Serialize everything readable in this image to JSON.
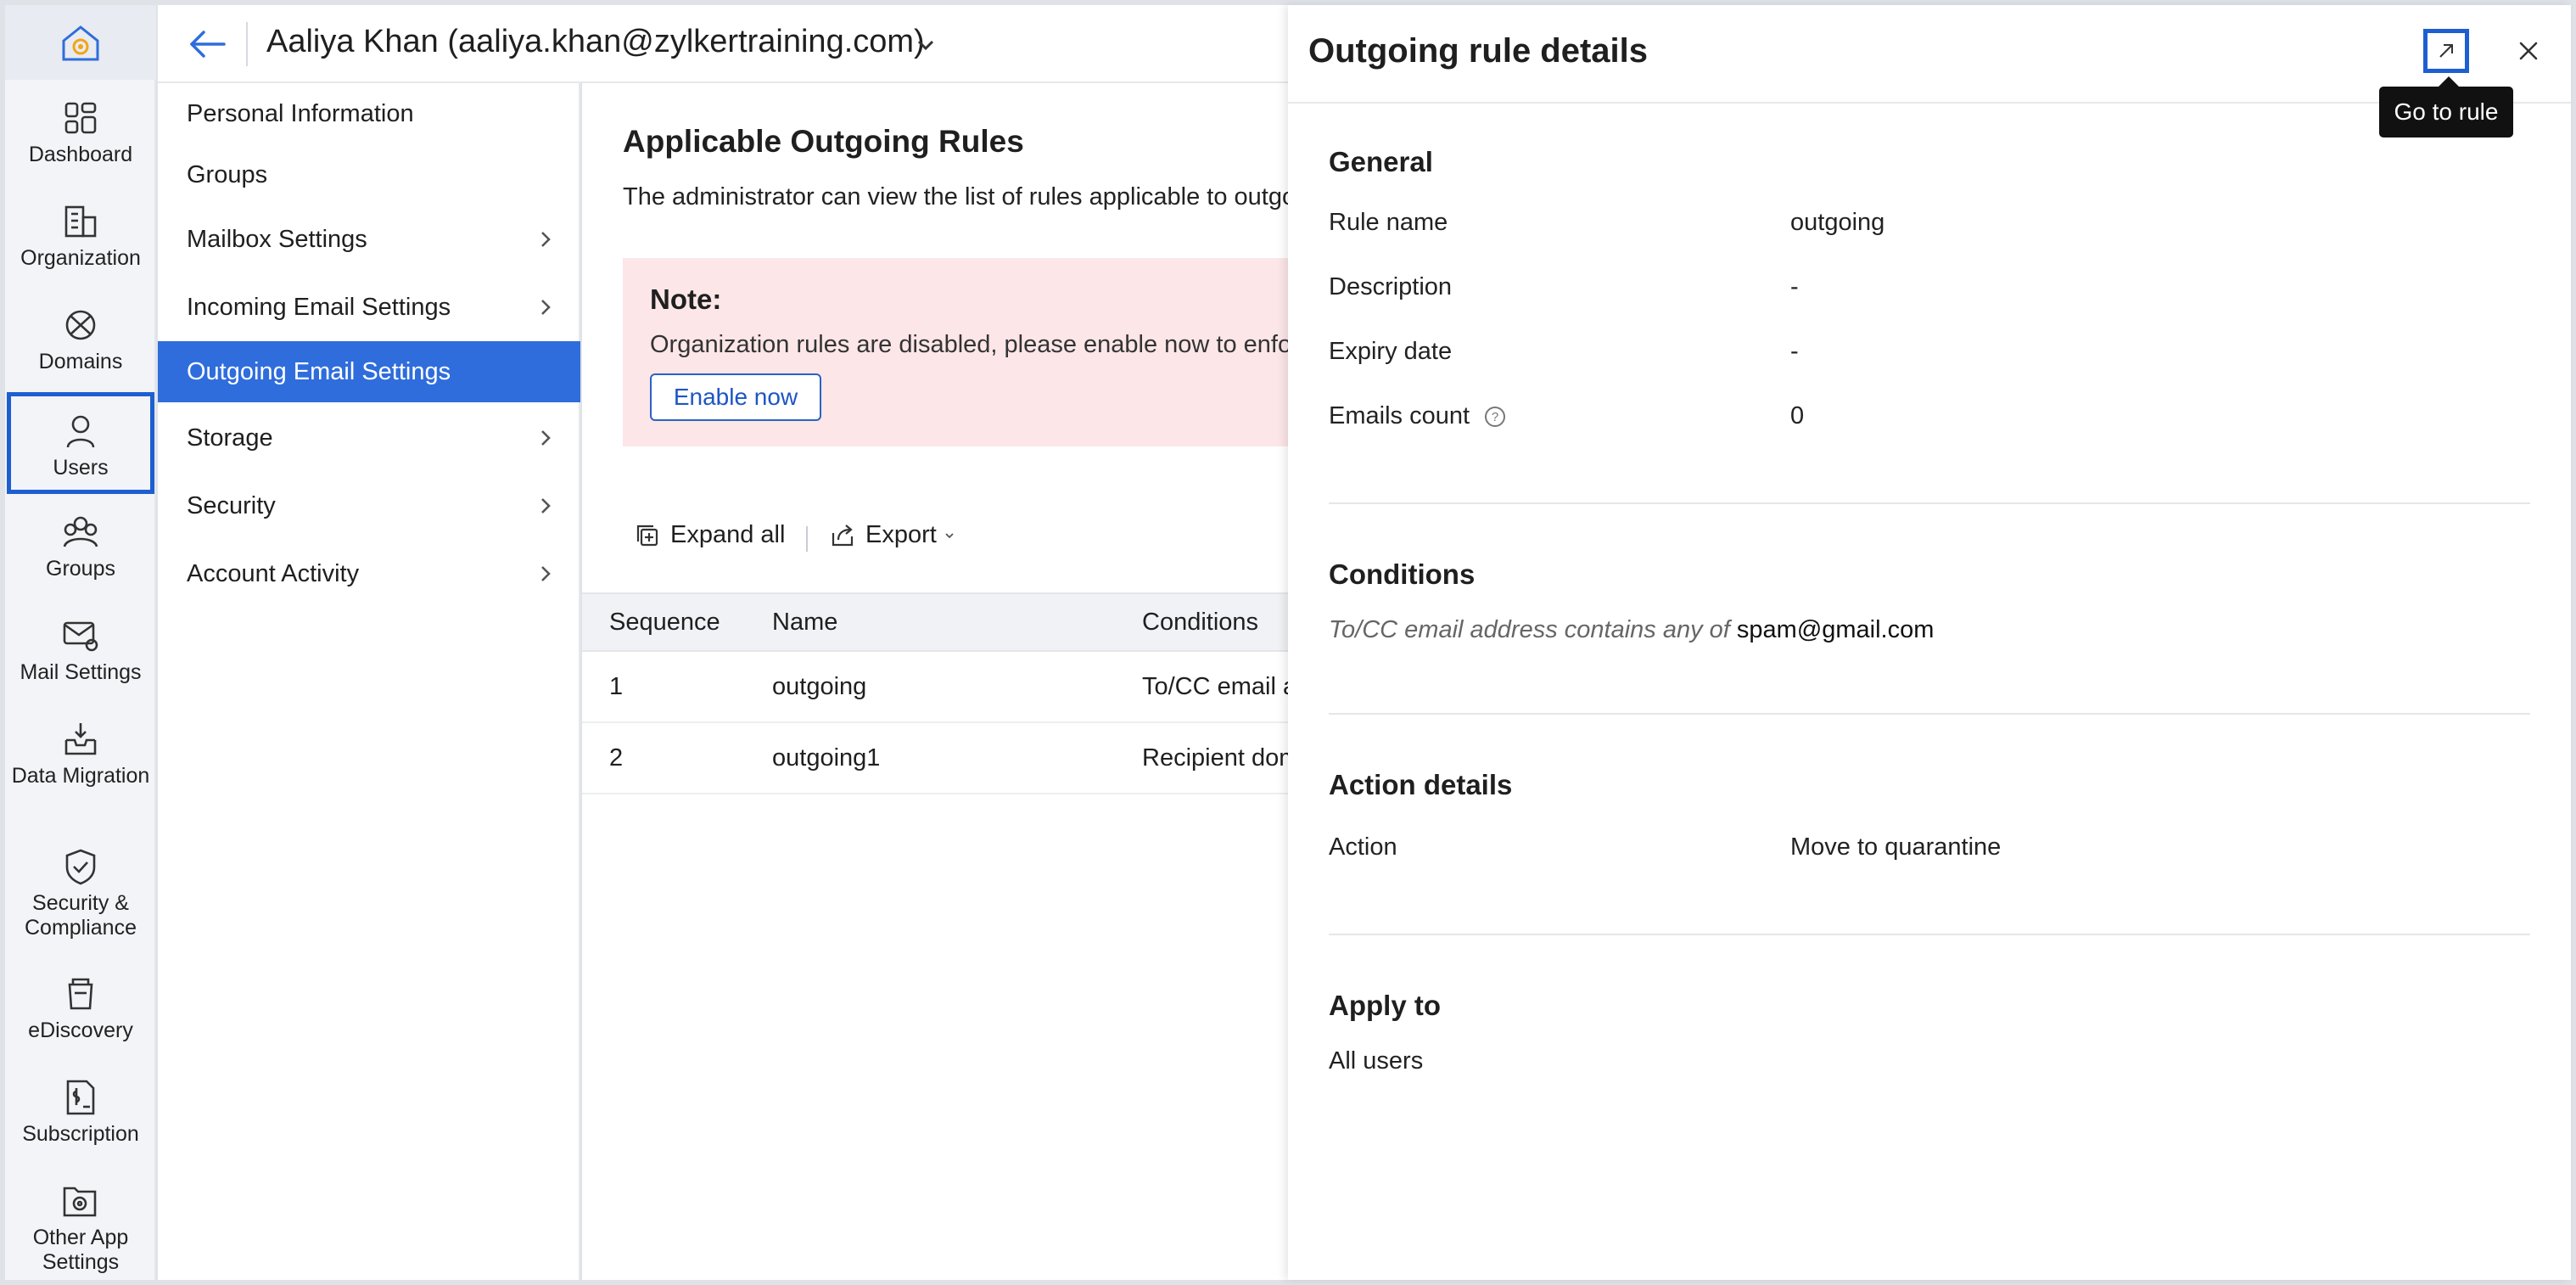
{
  "rail": {
    "items": [
      {
        "label": "Dashboard",
        "icon": "dashboard-icon"
      },
      {
        "label": "Organization",
        "icon": "organization-icon"
      },
      {
        "label": "Domains",
        "icon": "domains-icon"
      },
      {
        "label": "Users",
        "icon": "user-icon",
        "active": true
      },
      {
        "label": "Groups",
        "icon": "groups-icon"
      },
      {
        "label": "Mail Settings",
        "icon": "mail-settings-icon"
      },
      {
        "label": "Data Migration",
        "icon": "data-migration-icon"
      },
      {
        "label": "Security & Compliance",
        "icon": "shield-check-icon"
      },
      {
        "label": "eDiscovery",
        "icon": "ediscovery-icon"
      },
      {
        "label": "Subscription",
        "icon": "subscription-icon"
      },
      {
        "label": "Other App Settings",
        "icon": "app-settings-icon"
      }
    ]
  },
  "header": {
    "user_title": "Aaliya Khan (aaliya.khan@zylkertraining.com)"
  },
  "subnav": {
    "items": [
      {
        "label": "Personal Information",
        "has_chevron": false
      },
      {
        "label": "Groups",
        "has_chevron": false
      },
      {
        "label": "Mailbox Settings",
        "has_chevron": true
      },
      {
        "label": "Incoming Email Settings",
        "has_chevron": true
      },
      {
        "label": "Outgoing Email Settings",
        "has_chevron": false,
        "active": true
      },
      {
        "label": "Storage",
        "has_chevron": true
      },
      {
        "label": "Security",
        "has_chevron": true
      },
      {
        "label": "Account Activity",
        "has_chevron": true
      }
    ]
  },
  "main": {
    "title": "Applicable Outgoing Rules",
    "description": "The administrator can view the list of rules applicable to outgo",
    "note": {
      "title": "Note:",
      "text": "Organization rules are disabled, please enable now to enfo",
      "button": "Enable now"
    },
    "toolbar": {
      "expand_all": "Expand all",
      "export": "Export"
    },
    "table": {
      "columns": [
        "Sequence",
        "Name",
        "Conditions"
      ],
      "rows": [
        [
          "1",
          "outgoing",
          "To/CC email a"
        ],
        [
          "2",
          "outgoing1",
          "Recipient dom"
        ]
      ]
    }
  },
  "panel": {
    "title": "Outgoing rule details",
    "tooltip": "Go to rule",
    "general": {
      "heading": "General",
      "fields": [
        {
          "label": "Rule name",
          "value": "outgoing"
        },
        {
          "label": "Description",
          "value": "-"
        },
        {
          "label": "Expiry date",
          "value": "-"
        },
        {
          "label": "Emails count",
          "value": "0"
        }
      ]
    },
    "conditions": {
      "heading": "Conditions",
      "prefix": "To/CC email address contains any of",
      "value": "spam@gmail.com"
    },
    "action_details": {
      "heading": "Action details",
      "label": "Action",
      "value": "Move to quarantine"
    },
    "apply_to": {
      "heading": "Apply to",
      "value": "All users"
    }
  },
  "colors": {
    "accent": "#2f6ddc",
    "focus_outline": "#1d5fd1",
    "note_bg": "#fce6e8"
  }
}
